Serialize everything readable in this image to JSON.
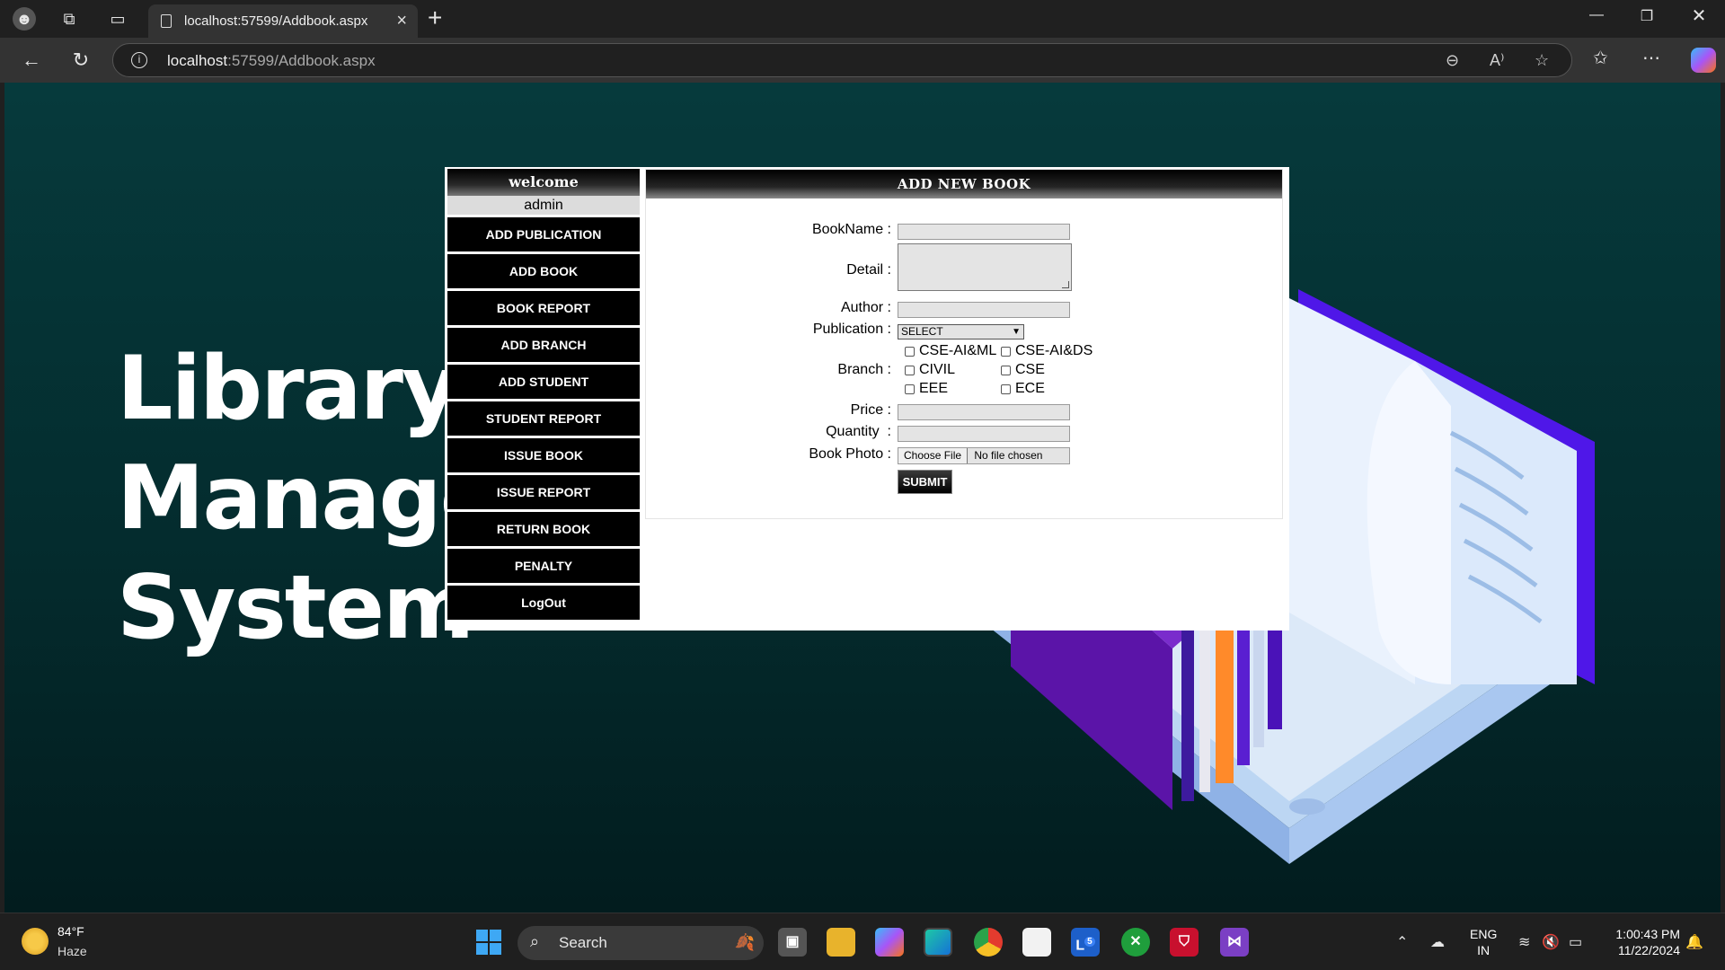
{
  "browser": {
    "tab_title": "localhost:57599/Addbook.aspx",
    "url_host": "localhost",
    "url_rest": ":57599/Addbook.aspx"
  },
  "hero": {
    "line1": "Library",
    "line2": "Manage",
    "line3": "System"
  },
  "sidebar": {
    "welcome": "welcome",
    "user": "admin",
    "items": [
      {
        "label": "ADD PUBLICATION"
      },
      {
        "label": "ADD BOOK"
      },
      {
        "label": "BOOK REPORT"
      },
      {
        "label": "ADD BRANCH"
      },
      {
        "label": "ADD STUDENT"
      },
      {
        "label": "STUDENT REPORT"
      },
      {
        "label": "ISSUE BOOK"
      },
      {
        "label": "ISSUE REPORT"
      },
      {
        "label": "RETURN BOOK"
      },
      {
        "label": "PENALTY"
      },
      {
        "label": "LogOut"
      }
    ]
  },
  "form": {
    "heading": "ADD NEW BOOK",
    "labels": {
      "bookname": "BookName :",
      "detail": "Detail :",
      "author": "Author :",
      "publication": "Publication :",
      "branch": "Branch :",
      "price": "Price :",
      "quantity": "Quantity  :",
      "photo": "Book Photo :"
    },
    "values": {
      "bookname": "",
      "detail": "",
      "author": "",
      "price": "",
      "quantity": ""
    },
    "publication_selected": "SELECT",
    "branches": [
      "CSE-AI&ML",
      "CSE-AI&DS",
      "CIVIL",
      "CSE",
      "EEE",
      "ECE"
    ],
    "file_button": "Choose File",
    "file_status": "No file chosen",
    "submit": "SUBMIT"
  },
  "taskbar": {
    "temperature": "84°F",
    "condition": "Haze",
    "search_placeholder": "Search",
    "lang_line1": "ENG",
    "lang_line2": "IN",
    "time": "1:00:43 PM",
    "date": "11/22/2024",
    "badge_count": "5"
  }
}
